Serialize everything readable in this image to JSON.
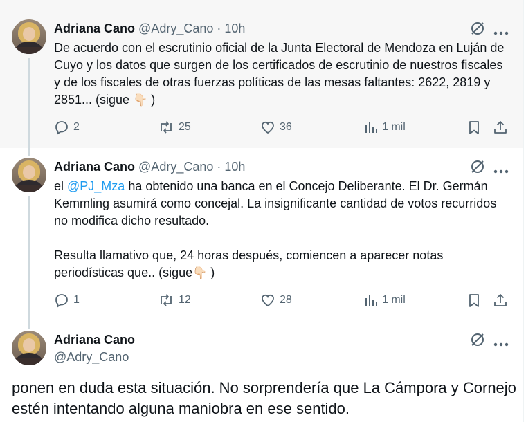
{
  "tweets": [
    {
      "name": "Adriana Cano",
      "handle": "@Adry_Cano",
      "sep": "·",
      "time": "10h",
      "text": "De acuerdo con el escrutinio oficial de la Junta Electoral de Mendoza en Luján de Cuyo y los datos que surgen de los certificados de escrutinio de nuestros fiscales y de los fiscales de otras fuerzas políticas de las mesas faltantes: 2622, 2819 y 2851... (sigue",
      "emoji": "👇🏻",
      "text_end": ")",
      "replies": "2",
      "reposts": "25",
      "likes": "36",
      "views": "1 mil"
    },
    {
      "name": "Adriana Cano",
      "handle": "@Adry_Cano",
      "sep": "·",
      "time": "10h",
      "text_pre": "el ",
      "mention": "@PJ_Mza",
      "text_post": " ha obtenido una banca en el Concejo Deliberante. El Dr. Germán Kemmling asumirá como concejal. La insignificante cantidad de votos recurridos no modifica dicho resultado.",
      "text_p2": "Resulta llamativo que, 24 horas después, comiencen a aparecer notas periodísticas que.. (sigue",
      "emoji": "👇🏻",
      "text_end": ")",
      "replies": "1",
      "reposts": "12",
      "likes": "28",
      "views": "1 mil"
    },
    {
      "name": "Adriana Cano",
      "handle": "@Adry_Cano",
      "text": "ponen en duda esta situación. No sorprendería que La Cámpora y Cornejo estén intentando alguna maniobra en ese sentido."
    }
  ],
  "icons": {
    "grok": "grok-icon",
    "more": "more-icon",
    "reply": "reply-icon",
    "repost": "repost-icon",
    "like": "like-icon",
    "views": "views-icon",
    "bookmark": "bookmark-icon",
    "share": "share-icon"
  },
  "colors": {
    "text": "#0f1419",
    "secondary": "#536471",
    "link": "#1d9bf0",
    "thread_line": "#cfd9de",
    "shaded_bg": "#f7f7f7"
  }
}
